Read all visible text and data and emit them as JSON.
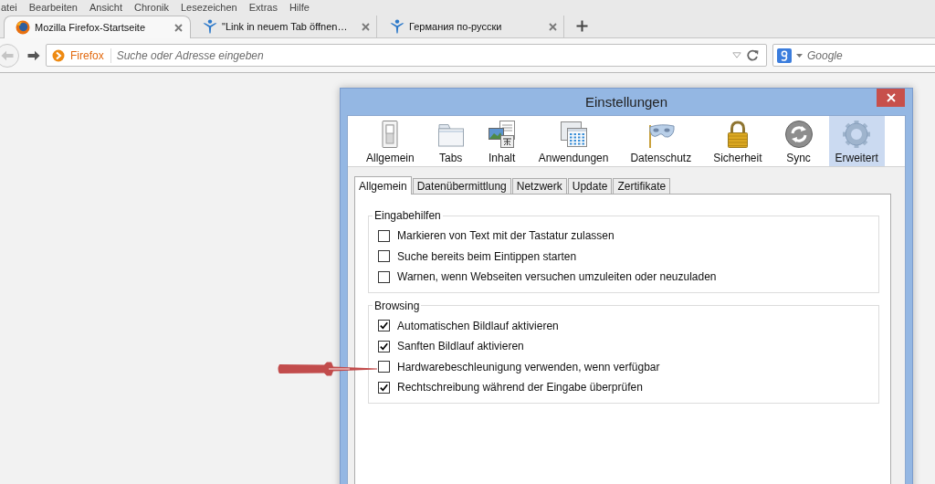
{
  "menu_bar": [
    "atei",
    "Bearbeiten",
    "Ansicht",
    "Chronik",
    "Lesezeichen",
    "Extras",
    "Hilfe"
  ],
  "browser_tabs": [
    {
      "kind": "home",
      "title": "Mozilla Firefox-Startseite",
      "selected": true
    },
    {
      "kind": "page",
      "title": "\"Link in neuem Tab öffnen…",
      "selected": false
    },
    {
      "kind": "page",
      "title": "Германия по-русски",
      "selected": false
    }
  ],
  "navigation": {
    "back": {
      "disabled": true
    },
    "forward": {
      "disabled": false
    },
    "address_field": {
      "identity": "Firefox",
      "placeholder": "Suche oder Adresse eingeben"
    },
    "search_field": {
      "placeholder": "Google"
    }
  },
  "dialog": {
    "title": "Einstellungen",
    "panes": [
      {
        "kind": "general",
        "label": "Allgemein",
        "selected": false
      },
      {
        "kind": "tabs",
        "label": "Tabs",
        "selected": false
      },
      {
        "kind": "content",
        "label": "Inhalt",
        "selected": false
      },
      {
        "kind": "applications",
        "label": "Anwendungen",
        "selected": false
      },
      {
        "kind": "privacy",
        "label": "Datenschutz",
        "selected": false
      },
      {
        "kind": "security",
        "label": "Sicherheit",
        "selected": false
      },
      {
        "kind": "sync",
        "label": "Sync",
        "selected": false
      },
      {
        "kind": "advanced",
        "label": "Erweitert",
        "selected": true
      }
    ],
    "tabs": [
      {
        "label": "Allgemein",
        "selected": true
      },
      {
        "label": "Datenübermittlung",
        "selected": false
      },
      {
        "label": "Netzwerk",
        "selected": false
      },
      {
        "label": "Update",
        "selected": false
      },
      {
        "label": "Zertifikate",
        "selected": false
      }
    ],
    "groups": [
      {
        "legend": "Eingabehilfen",
        "options": [
          {
            "label": "Markieren von Text mit der Tastatur zulassen",
            "checked": false
          },
          {
            "label": "Suche bereits beim Eintippen starten",
            "checked": false
          },
          {
            "label": "Warnen, wenn Webseiten versuchen umzuleiten oder neuzuladen",
            "checked": false
          }
        ]
      },
      {
        "legend": "Browsing",
        "options": [
          {
            "label": "Automatischen Bildlauf aktivieren",
            "checked": true
          },
          {
            "label": "Sanften Bildlauf aktivieren",
            "checked": true
          },
          {
            "label": "Hardwarebeschleunigung verwenden, wenn verfügbar",
            "checked": false
          },
          {
            "label": "Rechtschreibung während der Eingabe überprüfen",
            "checked": true
          }
        ]
      }
    ]
  }
}
